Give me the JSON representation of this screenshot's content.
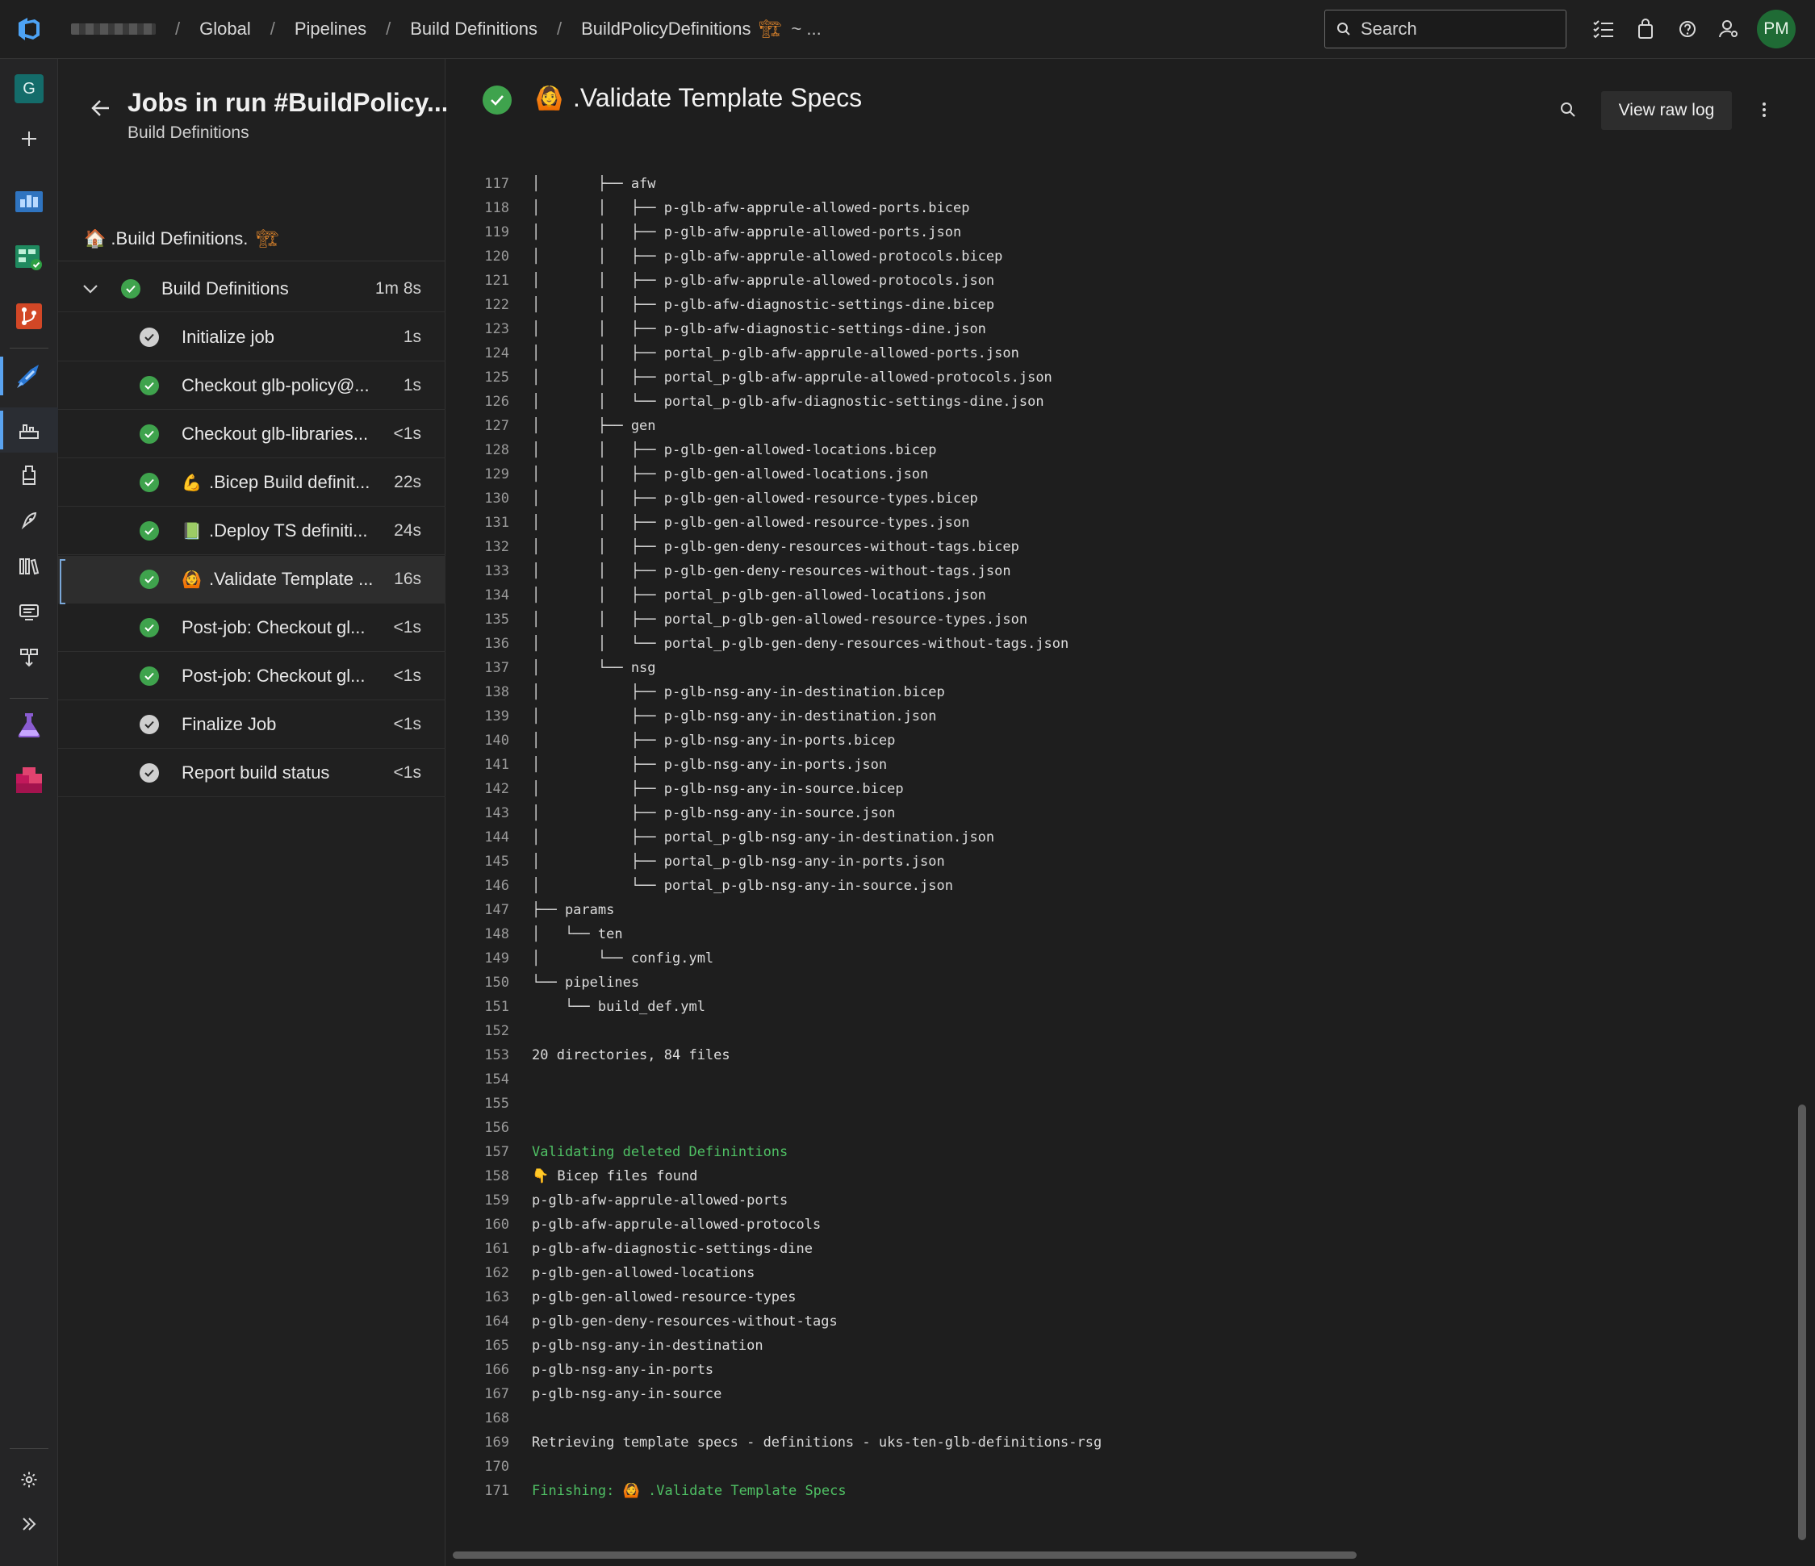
{
  "breadcrumbs": {
    "items": [
      "Global",
      "Pipelines",
      "Build Definitions",
      "BuildPolicyDefinitions"
    ],
    "badge": "🏗",
    "more": "~ ..."
  },
  "search": {
    "placeholder": "Search"
  },
  "user": {
    "initials": "PM"
  },
  "project": {
    "initial": "G"
  },
  "jobs_panel": {
    "title": "Jobs in run #BuildPolicy...",
    "subtitle": "Build Definitions",
    "stage": {
      "emoji": "🏠",
      "label": ".Build Definitions.",
      "badge": "🏗"
    },
    "job": {
      "label": "Build Definitions",
      "duration": "1m 8s"
    },
    "steps": [
      {
        "label": "Initialize job",
        "duration": "1s",
        "status": "neutral",
        "emoji": ""
      },
      {
        "label": "Checkout glb-policy@...",
        "duration": "1s",
        "status": "ok",
        "emoji": ""
      },
      {
        "label": "Checkout glb-libraries...",
        "duration": "<1s",
        "status": "ok",
        "emoji": ""
      },
      {
        "label": ".Bicep Build definit...",
        "duration": "22s",
        "status": "ok",
        "emoji": "💪"
      },
      {
        "label": ".Deploy TS definiti...",
        "duration": "24s",
        "status": "ok",
        "emoji": "📗"
      },
      {
        "label": ".Validate Template ...",
        "duration": "16s",
        "status": "ok",
        "emoji": "🙆"
      },
      {
        "label": "Post-job: Checkout gl...",
        "duration": "<1s",
        "status": "ok",
        "emoji": ""
      },
      {
        "label": "Post-job: Checkout gl...",
        "duration": "<1s",
        "status": "ok",
        "emoji": ""
      },
      {
        "label": "Finalize Job",
        "duration": "<1s",
        "status": "neutral",
        "emoji": ""
      },
      {
        "label": "Report build status",
        "duration": "<1s",
        "status": "neutral",
        "emoji": ""
      }
    ]
  },
  "log": {
    "emoji": "🙆",
    "title": ".Validate Template Specs",
    "raw_button": "View raw log",
    "lines": [
      {
        "n": "117",
        "t": "│       ├── afw"
      },
      {
        "n": "118",
        "t": "│       │   ├── p-glb-afw-apprule-allowed-ports.bicep"
      },
      {
        "n": "119",
        "t": "│       │   ├── p-glb-afw-apprule-allowed-ports.json"
      },
      {
        "n": "120",
        "t": "│       │   ├── p-glb-afw-apprule-allowed-protocols.bicep"
      },
      {
        "n": "121",
        "t": "│       │   ├── p-glb-afw-apprule-allowed-protocols.json"
      },
      {
        "n": "122",
        "t": "│       │   ├── p-glb-afw-diagnostic-settings-dine.bicep"
      },
      {
        "n": "123",
        "t": "│       │   ├── p-glb-afw-diagnostic-settings-dine.json"
      },
      {
        "n": "124",
        "t": "│       │   ├── portal_p-glb-afw-apprule-allowed-ports.json"
      },
      {
        "n": "125",
        "t": "│       │   ├── portal_p-glb-afw-apprule-allowed-protocols.json"
      },
      {
        "n": "126",
        "t": "│       │   └── portal_p-glb-afw-diagnostic-settings-dine.json"
      },
      {
        "n": "127",
        "t": "│       ├── gen"
      },
      {
        "n": "128",
        "t": "│       │   ├── p-glb-gen-allowed-locations.bicep"
      },
      {
        "n": "129",
        "t": "│       │   ├── p-glb-gen-allowed-locations.json"
      },
      {
        "n": "130",
        "t": "│       │   ├── p-glb-gen-allowed-resource-types.bicep"
      },
      {
        "n": "131",
        "t": "│       │   ├── p-glb-gen-allowed-resource-types.json"
      },
      {
        "n": "132",
        "t": "│       │   ├── p-glb-gen-deny-resources-without-tags.bicep"
      },
      {
        "n": "133",
        "t": "│       │   ├── p-glb-gen-deny-resources-without-tags.json"
      },
      {
        "n": "134",
        "t": "│       │   ├── portal_p-glb-gen-allowed-locations.json"
      },
      {
        "n": "135",
        "t": "│       │   ├── portal_p-glb-gen-allowed-resource-types.json"
      },
      {
        "n": "136",
        "t": "│       │   └── portal_p-glb-gen-deny-resources-without-tags.json"
      },
      {
        "n": "137",
        "t": "│       └── nsg"
      },
      {
        "n": "138",
        "t": "│           ├── p-glb-nsg-any-in-destination.bicep"
      },
      {
        "n": "139",
        "t": "│           ├── p-glb-nsg-any-in-destination.json"
      },
      {
        "n": "140",
        "t": "│           ├── p-glb-nsg-any-in-ports.bicep"
      },
      {
        "n": "141",
        "t": "│           ├── p-glb-nsg-any-in-ports.json"
      },
      {
        "n": "142",
        "t": "│           ├── p-glb-nsg-any-in-source.bicep"
      },
      {
        "n": "143",
        "t": "│           ├── p-glb-nsg-any-in-source.json"
      },
      {
        "n": "144",
        "t": "│           ├── portal_p-glb-nsg-any-in-destination.json"
      },
      {
        "n": "145",
        "t": "│           ├── portal_p-glb-nsg-any-in-ports.json"
      },
      {
        "n": "146",
        "t": "│           └── portal_p-glb-nsg-any-in-source.json"
      },
      {
        "n": "147",
        "t": "├── params"
      },
      {
        "n": "148",
        "t": "│   └── ten"
      },
      {
        "n": "149",
        "t": "│       └── config.yml"
      },
      {
        "n": "150",
        "t": "└── pipelines"
      },
      {
        "n": "151",
        "t": "    └── build_def.yml"
      },
      {
        "n": "152",
        "t": ""
      },
      {
        "n": "153",
        "t": "20 directories, 84 files"
      },
      {
        "n": "154",
        "t": ""
      },
      {
        "n": "155",
        "t": ""
      },
      {
        "n": "156",
        "t": ""
      },
      {
        "n": "157",
        "t": "Validating deleted Definintions",
        "green": true
      },
      {
        "n": "158",
        "t": "👇 Bicep files found"
      },
      {
        "n": "159",
        "t": "p-glb-afw-apprule-allowed-ports"
      },
      {
        "n": "160",
        "t": "p-glb-afw-apprule-allowed-protocols"
      },
      {
        "n": "161",
        "t": "p-glb-afw-diagnostic-settings-dine"
      },
      {
        "n": "162",
        "t": "p-glb-gen-allowed-locations"
      },
      {
        "n": "163",
        "t": "p-glb-gen-allowed-resource-types"
      },
      {
        "n": "164",
        "t": "p-glb-gen-deny-resources-without-tags"
      },
      {
        "n": "165",
        "t": "p-glb-nsg-any-in-destination"
      },
      {
        "n": "166",
        "t": "p-glb-nsg-any-in-ports"
      },
      {
        "n": "167",
        "t": "p-glb-nsg-any-in-source"
      },
      {
        "n": "168",
        "t": ""
      },
      {
        "n": "169",
        "t": "Retrieving template specs - definitions - uks-ten-glb-definitions-rsg"
      },
      {
        "n": "170",
        "t": ""
      },
      {
        "n": "171",
        "t": "Finishing: 🙆 .Validate Template Specs",
        "green": true
      }
    ]
  },
  "colors": {
    "success": "#3fa34d",
    "log_green": "#4fc064",
    "accent": "#5aa3f0",
    "avatar": "#1f6b35"
  }
}
